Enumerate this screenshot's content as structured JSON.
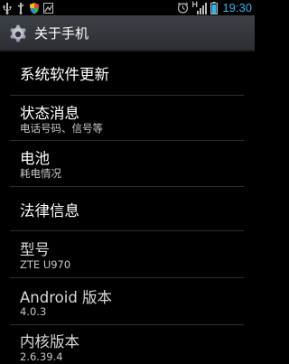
{
  "status_bar": {
    "time": "19:30",
    "network_type": "H",
    "left_icons": [
      "usb-icon",
      "usb-debug-icon",
      "shield-icon",
      "photo-icon"
    ],
    "right_icons": [
      "alarm-icon",
      "signal-icon",
      "battery-icon"
    ]
  },
  "action_bar": {
    "icon": "settings-gear-icon",
    "title": "关于手机"
  },
  "items": [
    {
      "title": "系统软件更新",
      "subtitle": ""
    },
    {
      "title": "状态消息",
      "subtitle": "电话号码、信号等"
    },
    {
      "title": "电池",
      "subtitle": "耗电情况"
    },
    {
      "title": "法律信息",
      "subtitle": ""
    },
    {
      "title": "型号",
      "subtitle": "ZTE U970"
    },
    {
      "title": "Android 版本",
      "subtitle": "4.0.3"
    },
    {
      "title": "内核版本",
      "subtitle": "2.6.39.4"
    }
  ],
  "colors": {
    "background": "#000000",
    "accent": "#3ab4e8",
    "action_bar": "#34373c",
    "divider": "#2d2d2d"
  }
}
